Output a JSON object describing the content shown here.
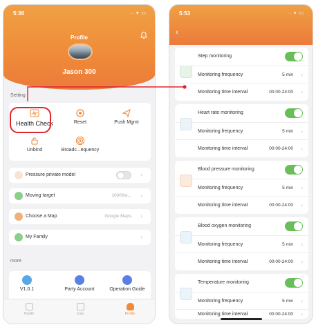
{
  "left": {
    "status_time": "5:36",
    "status_icons": "·· ▾ ▭",
    "title": "Profile",
    "username": "Jason 300",
    "settings_label": "Setting",
    "grid": [
      {
        "label": "Health Check",
        "icon": "heart-line-icon"
      },
      {
        "label": "Reset",
        "icon": "reset-icon"
      },
      {
        "label": "Push Mgmt",
        "icon": "push-icon"
      },
      {
        "label": "Unbind",
        "icon": "unbind-icon"
      },
      {
        "label": "Broadc...equency",
        "icon": "broadcast-icon"
      }
    ],
    "rows": [
      {
        "label": "Pressure private model",
        "value": ""
      },
      {
        "label": "Moving target",
        "value": "10000st..."
      },
      {
        "label": "Choose a Map",
        "value": "Google Maps"
      },
      {
        "label": "My Family",
        "value": ""
      }
    ],
    "more_label": "more",
    "more_items": [
      {
        "label": "V1.0.1"
      },
      {
        "label": "Party Account"
      },
      {
        "label": "Operation Guide"
      }
    ],
    "tabs": [
      {
        "label": "Health"
      },
      {
        "label": "Care"
      },
      {
        "label": "Profile"
      }
    ]
  },
  "right": {
    "status_time": "5:53",
    "status_icons": "·· ▾ ▭",
    "back": "‹",
    "groups": [
      {
        "title": "Step monitoring",
        "freq_label": "Monitoring frequency",
        "freq": "5 min",
        "interval_label": "Monitoring time interval",
        "interval": "00:00-24:00"
      },
      {
        "title": "Heart rate monitoring",
        "freq_label": "Monitoring frequency",
        "freq": "5 min",
        "interval_label": "Monitoring time interval",
        "interval": "00:00-24:00"
      },
      {
        "title": "Blood pressure monitoring",
        "freq_label": "Monitoring frequency",
        "freq": "5 min",
        "interval_label": "Monitoring time interval",
        "interval": "00:00-24:00"
      },
      {
        "title": "Blood oxygen monitoring",
        "freq_label": "Monitoring frequency",
        "freq": "5 min",
        "interval_label": "Monitoring time interval",
        "interval": "00:00-24:00"
      },
      {
        "title": "Temperature monitoring",
        "freq_label": "Monitoring frequency",
        "freq": "5 min",
        "interval_label": "Monitoring time interval",
        "interval": "00:00-24:00"
      }
    ]
  },
  "colors": {
    "accent": "#ef8a3a",
    "toggle_on": "#6abe5a",
    "highlight": "#e0232d"
  }
}
